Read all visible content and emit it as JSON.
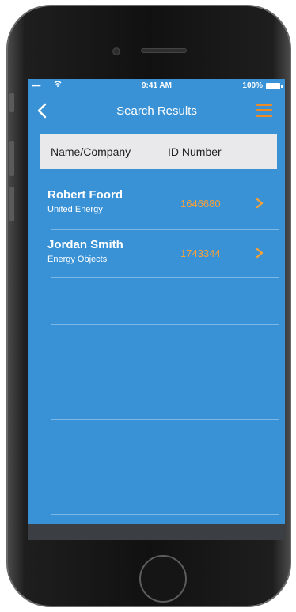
{
  "status_bar": {
    "signal": "•••••",
    "time": "9:41 AM",
    "battery": "100%"
  },
  "nav": {
    "title": "Search Results"
  },
  "table_header": {
    "name_col": "Name/Company",
    "id_col": "ID Number"
  },
  "results": [
    {
      "name": "Robert Foord",
      "company": "United Energy",
      "id": "1646680"
    },
    {
      "name": "Jordan Smith",
      "company": "Energy Objects",
      "id": "1743344"
    }
  ],
  "colors": {
    "screen_bg": "#3a92d6",
    "accent": "#f08a22",
    "id_text": "#f4a13a",
    "header_bg": "#e9e9ec"
  }
}
